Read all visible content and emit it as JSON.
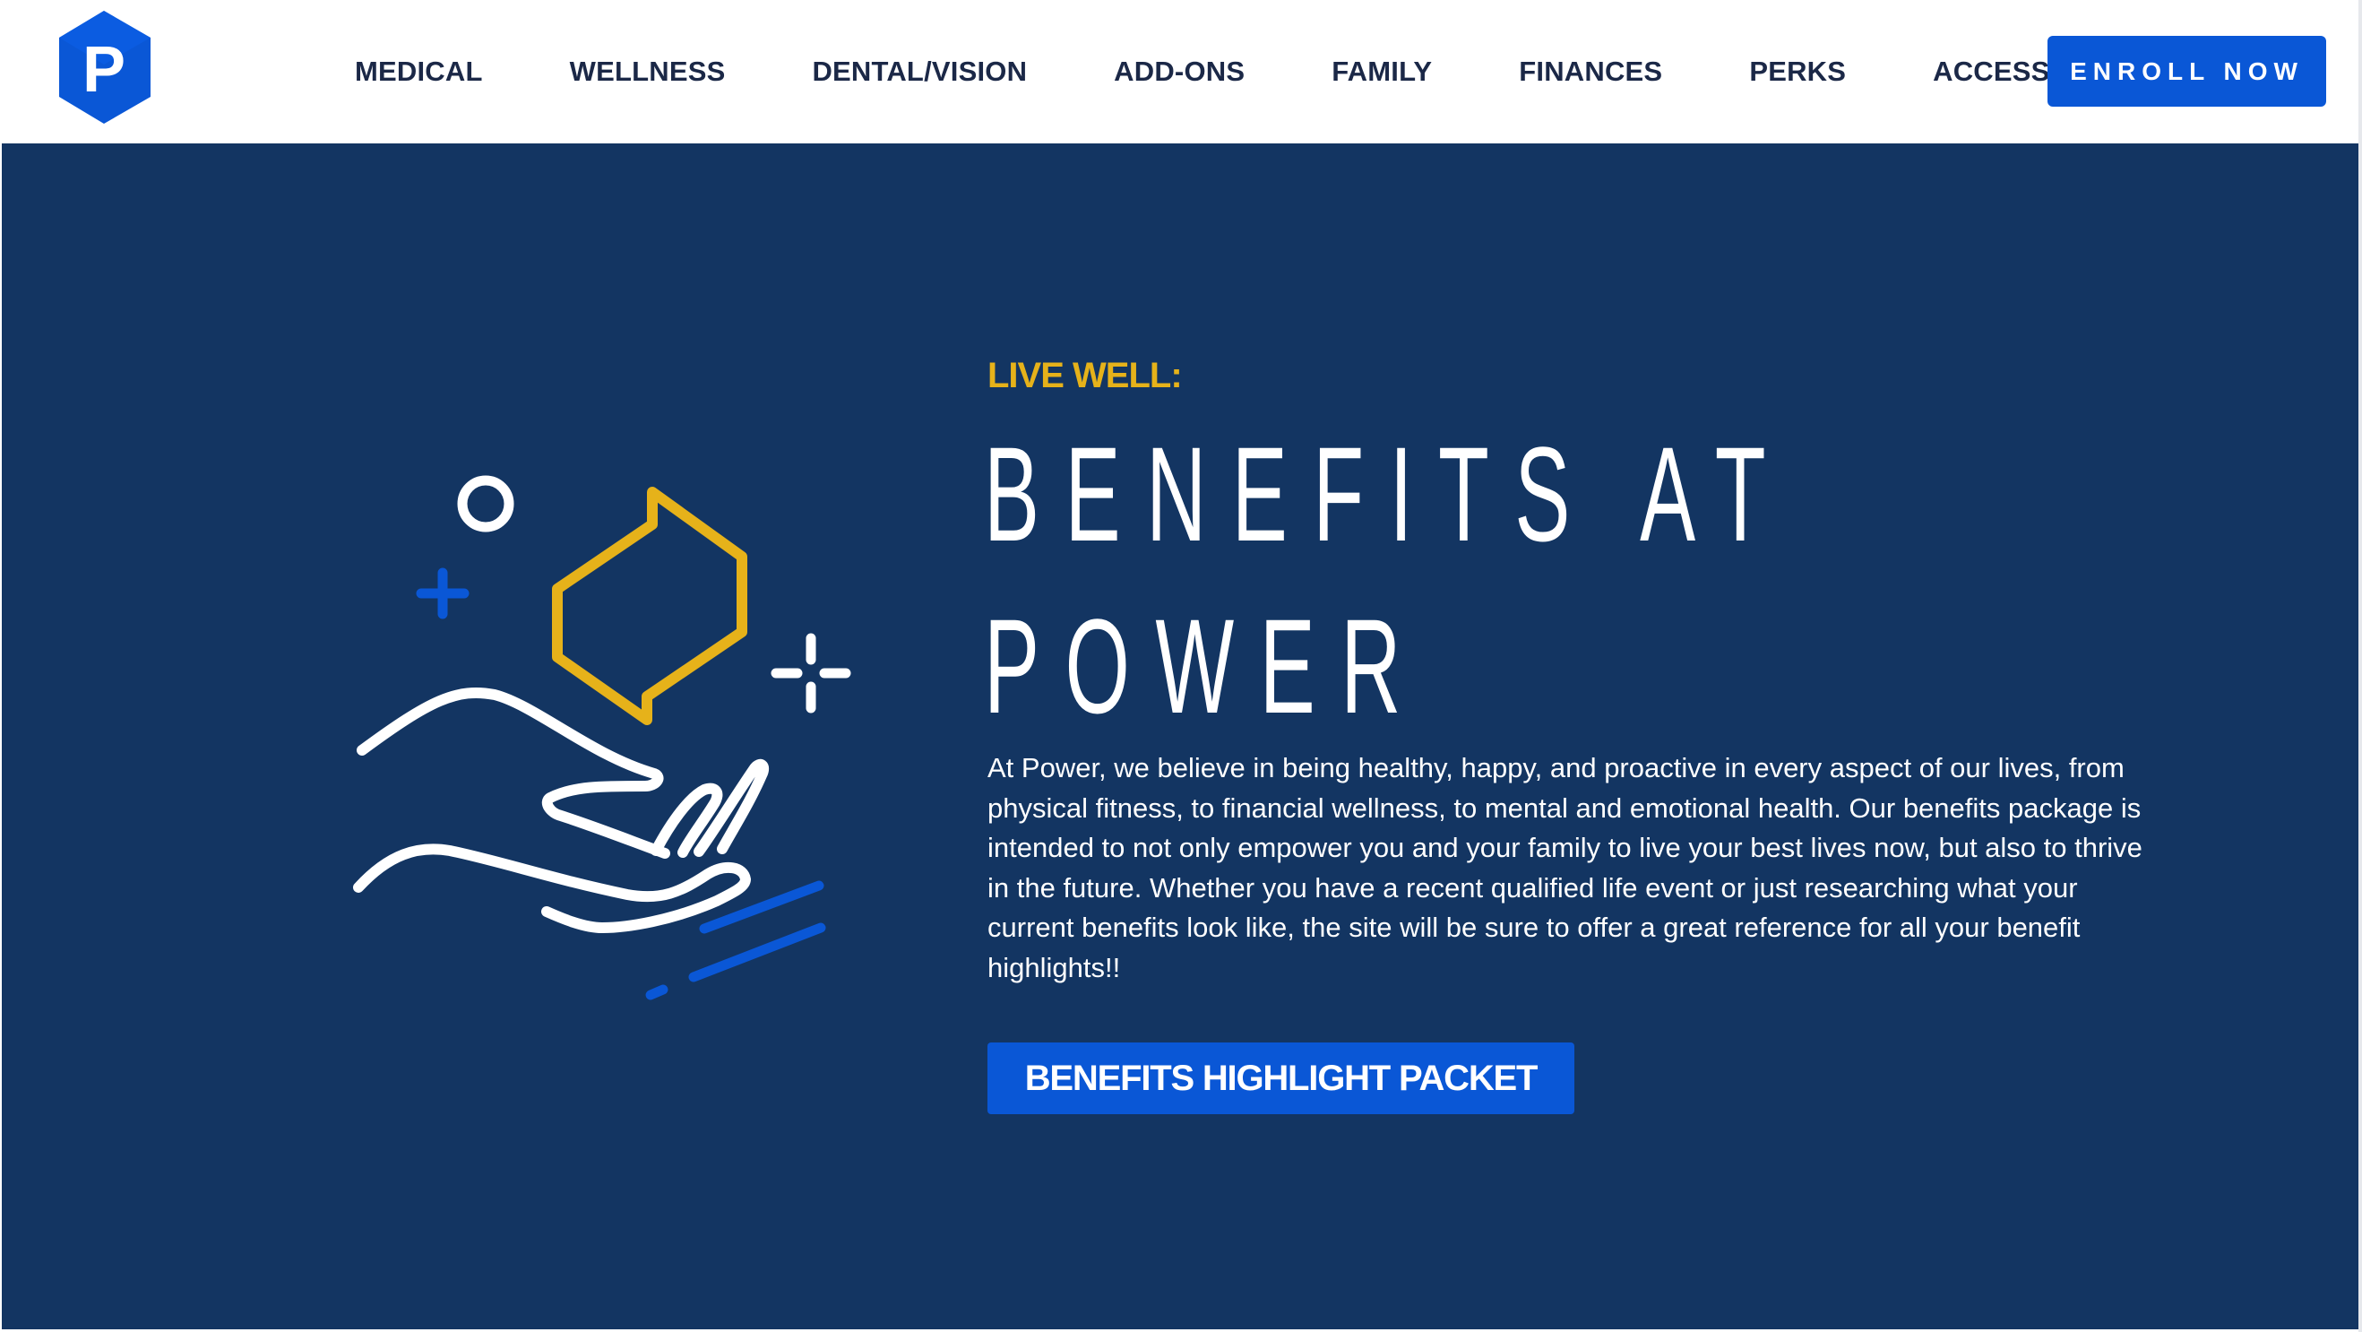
{
  "header": {
    "logo_letter": "P",
    "nav": [
      {
        "label": "MEDICAL"
      },
      {
        "label": "WELLNESS"
      },
      {
        "label": "DENTAL/VISION"
      },
      {
        "label": "ADD-ONS"
      },
      {
        "label": "FAMILY"
      },
      {
        "label": "FINANCES"
      },
      {
        "label": "PERKS"
      },
      {
        "label": "ACCESS"
      }
    ],
    "enroll_label": "ENROLL NOW"
  },
  "hero": {
    "eyebrow": "LIVE WELL:",
    "title_line1": "BENEFITS AT",
    "title_line2": "POWER",
    "description": "At Power, we believe in being healthy, happy, and proactive in every aspect of our lives, from physical fitness, to financial wellness, to mental and emotional health. Our benefits package is intended to not only empower you and your family to live your best lives now, but also to thrive in the future. Whether you have a recent qualified life event or just researching what your current benefits look like, the site will be sure to offer a great reference for all your benefit highlights!!",
    "button_label": "BENEFITS HIGHLIGHT PACKET"
  },
  "colors": {
    "navy": "#133562",
    "brand_blue": "#0a57d6",
    "gold": "#e6b21a",
    "nav_text": "#1b2847"
  },
  "icons": {
    "logo": "hexagon-p-logo",
    "illustration": "hand-offering-hexagon-icon"
  }
}
